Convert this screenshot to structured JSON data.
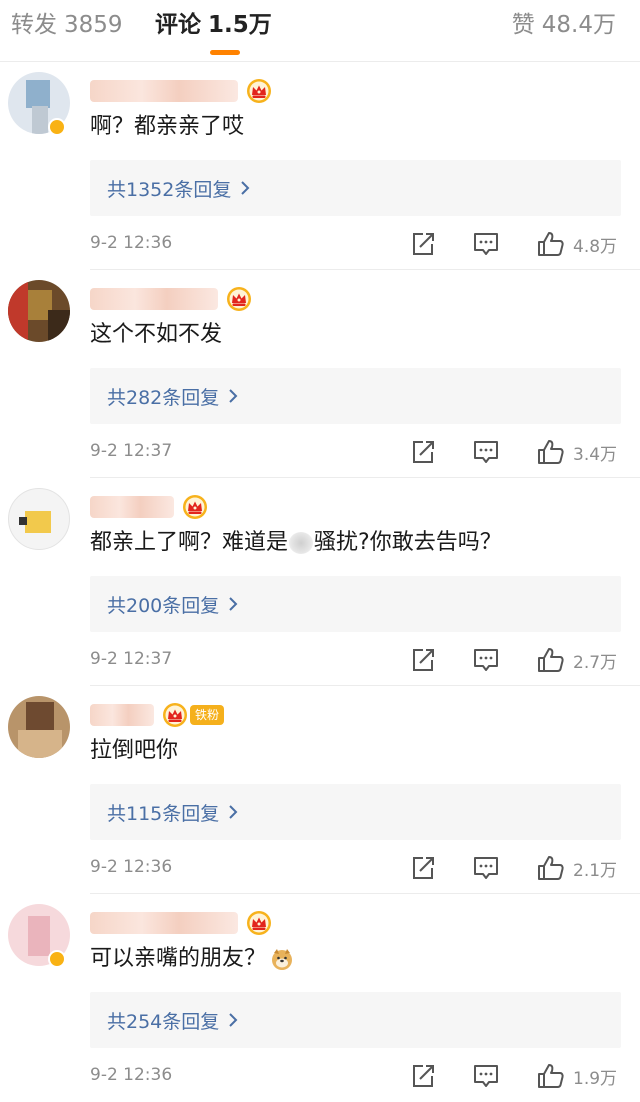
{
  "tabs": {
    "repost": {
      "label": "转发",
      "count": "3859"
    },
    "comment": {
      "label": "评论",
      "count": "1.5万"
    },
    "like": {
      "label": "赞",
      "count": "48.4万"
    }
  },
  "accent_color": "#ff8200",
  "link_color": "#4a6fa5",
  "comments": [
    {
      "text": "啊？都亲亲了哎",
      "replies": "共1352条回复",
      "time": "9-2 12:36",
      "likes": "4.8万"
    },
    {
      "text": "这个不如不发",
      "replies": "共282条回复",
      "time": "9-2 12:37",
      "likes": "3.4万"
    },
    {
      "text_a": "都亲上了啊？难道是",
      "text_b": "骚扰?你敢去告吗？",
      "replies": "共200条回复",
      "time": "9-2 12:37",
      "likes": "2.7万"
    },
    {
      "text": "拉倒吧你",
      "fan_badge": "铁粉",
      "replies": "共115条回复",
      "time": "9-2 12:36",
      "likes": "2.1万"
    },
    {
      "text": "可以亲嘴的朋友？",
      "emoji": "doge-emoji",
      "replies": "共254条回复",
      "time": "9-2 12:36",
      "likes": "1.9万"
    }
  ],
  "icons": [
    "crown-icon",
    "repost-icon",
    "reply-icon",
    "like-icon",
    "chevron-right-icon"
  ]
}
